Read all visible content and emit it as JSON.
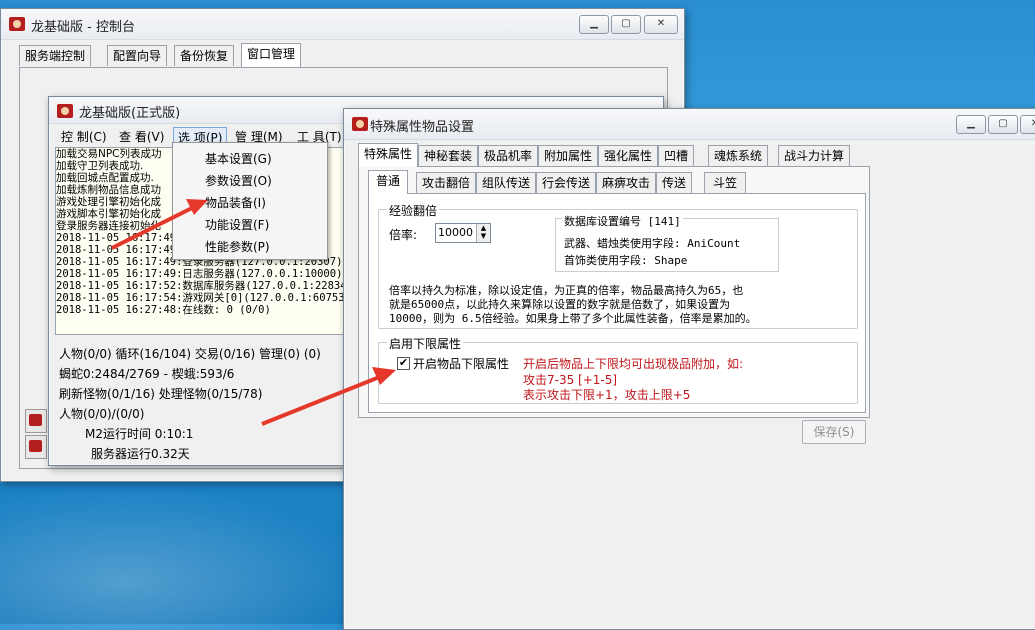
{
  "main_window": {
    "title": "龙基础版 - 控制台",
    "tabs": [
      "服务端控制",
      "配置向导",
      "备份恢复",
      "窗口管理"
    ]
  },
  "sub_window": {
    "title": "龙基础版(正式版)",
    "menu": [
      "控 制(C)",
      "查 看(V)",
      "选 项(P)",
      "管 理(M)",
      "工 具(T)"
    ],
    "log_text_lines": [
      "加载交易NPC列表成功",
      "加载守卫列表成功.",
      "加载回城点配置成功.",
      "加载炼制物品信息成功",
      "游戏处理引擎初始化成",
      "游戏脚本引擎初始化成",
      "登录服务器连接初始化"
    ],
    "log_lines": [
      "2018-11-05 16:17:49",
      "2018-11-05 16:17:49",
      "2018-11-05 16:17:49:登录服务器(127.0.0.1:20307)",
      "2018-11-05 16:17:49:日志服务器(127.0.0.1:10000)",
      "2018-11-05 16:17:52:数据库服务器(127.0.0.1:22834",
      "2018-11-05 16:17:54:游戏网关[0](127.0.0.1:60753",
      "2018-11-05 16:27:48:在线数: 0 (0/0)"
    ],
    "stats": [
      "人物(0/0) 循环(16/104) 交易(0/16) 管理(0) (0)",
      "蝎蛇0:2484/2769 - 楔蛾:593/6",
      "刷新怪物(0/1/16) 处理怪物(0/15/78)",
      "人物(0/0)/(0/0)"
    ],
    "runtime": "M2运行时间 0:10:1",
    "server_runtime": "服务器运行0.32天"
  },
  "dropdown": {
    "items": [
      "基本设置(G)",
      "参数设置(O)",
      "物品装备(I)",
      "功能设置(F)",
      "性能参数(P)"
    ]
  },
  "dialog": {
    "title": "特殊属性物品设置",
    "tabs_row1": [
      "特殊属性",
      "神秘套装",
      "极品机率",
      "附加属性",
      "强化属性",
      "凹槽",
      "魂炼系统",
      "战斗力计算"
    ],
    "tabs_row2": [
      "普通",
      "攻击翻倍",
      "组队传送",
      "行会传送",
      "麻痹攻击",
      "传送",
      "斗笠"
    ],
    "exp_group": {
      "title": "经验翻倍",
      "rate_label": "倍率:",
      "rate_value": "10000",
      "db_box_title": "数据库设置编号 [141]",
      "db_line1": "武器、蜡烛类使用字段: AniCount",
      "db_line2": "首饰类使用字段: Shape",
      "desc_line1": "倍率以持久为标准，除以设定值，为正真的倍率，物品最高持久为65，也",
      "desc_line2": "就是65000点，以此持久来算除以设置的数字就是倍数了，如果设置为",
      "desc_line3": "10000，则为 6.5倍经验。如果身上带了多个此属性装备，倍率是累加的。"
    },
    "limit_group": {
      "title": "启用下限属性",
      "checkbox_label": "开启物品下限属性",
      "checked": true,
      "red_line1": "开启后物品上下限均可出现极品附加，如:",
      "red_line2": "攻击7-35  [+1-5]",
      "red_line3": "表示攻击下限+1，攻击上限+5"
    },
    "save_label": "保存(S)"
  },
  "colors": {
    "accent_red": "#c0161b",
    "arrow_red": "#e5382a"
  }
}
